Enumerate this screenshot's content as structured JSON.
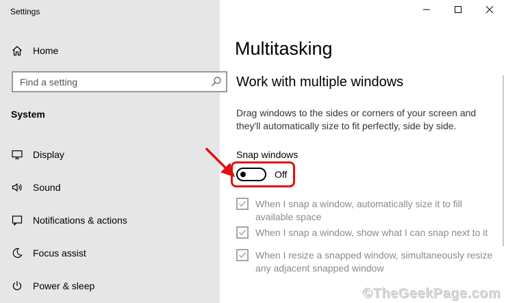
{
  "window": {
    "title": "Settings",
    "controls": {
      "minimize": "minimize-icon",
      "maximize": "maximize-icon",
      "close": "close-icon"
    }
  },
  "sidebar": {
    "home_label": "Home",
    "search_placeholder": "Find a setting",
    "section_label": "System",
    "items": [
      {
        "label": "Display",
        "icon": "display-icon"
      },
      {
        "label": "Sound",
        "icon": "speaker-icon"
      },
      {
        "label": "Notifications & actions",
        "icon": "notifications-icon"
      },
      {
        "label": "Focus assist",
        "icon": "moon-icon"
      },
      {
        "label": "Power & sleep",
        "icon": "power-icon"
      }
    ]
  },
  "main": {
    "page_title": "Multitasking",
    "section_title": "Work with multiple windows",
    "description": "Drag windows to the sides or corners of your screen and they'll automatically size to fit perfectly, side by side.",
    "snap": {
      "label": "Snap windows",
      "state_text": "Off",
      "on": false
    },
    "options": [
      {
        "text": "When I snap a window, automatically size it to fill available space",
        "checked": true,
        "enabled": false
      },
      {
        "text": "When I snap a window, show what I can snap next to it",
        "checked": true,
        "enabled": false
      },
      {
        "text": "When I resize a snapped window, simultaneously resize any adjacent snapped window",
        "checked": true,
        "enabled": false
      }
    ]
  },
  "annotation": {
    "color": "#e01010"
  },
  "watermark": "©TheGeekPage.com"
}
